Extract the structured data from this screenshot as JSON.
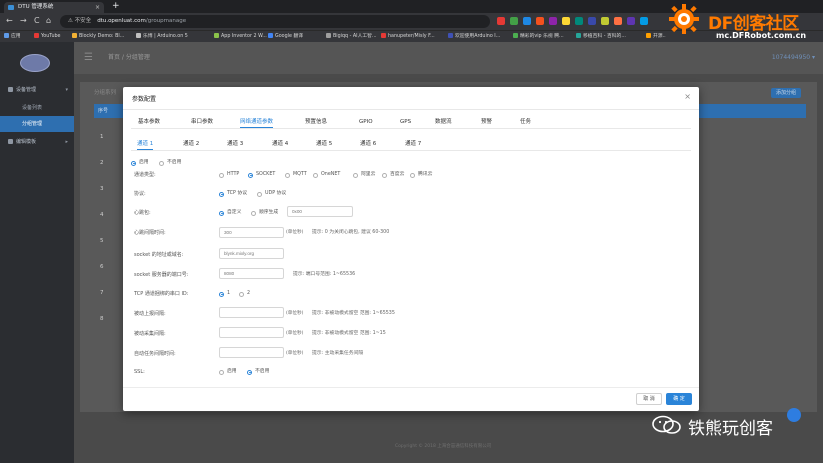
{
  "browser": {
    "tab_title": "DTU 管理系统",
    "tab_close": "×",
    "new_tab": "+",
    "back": "←",
    "forward": "→",
    "reload": "C",
    "home": "⌂",
    "security_label": "⚠ 不安全",
    "url_host": "dtu.openluat.com",
    "url_path": "/groupmanage",
    "bookmarks": [
      {
        "label": "应用",
        "color": "#5f9be8"
      },
      {
        "label": "YouTube",
        "color": "#e53935"
      },
      {
        "label": "Blockly Demo: Bl...",
        "color": "#f2b134"
      },
      {
        "label": "乐博 | Arduino.on 5",
        "color": "#c0c0c0"
      },
      {
        "label": "App Inventor 2 W...",
        "color": "#8bc34a"
      },
      {
        "label": "Google 翻译",
        "color": "#4285f4"
      },
      {
        "label": "Bigiqq - AI人工智...",
        "color": "#9e9e9e"
      },
      {
        "label": "hanupeter/Misly F...",
        "color": "#e53935"
      },
      {
        "label": "欢迎使用Arduino I...",
        "color": "#3f51b5"
      },
      {
        "label": "精彩的vip 乐视 腾...",
        "color": "#4caf50"
      },
      {
        "label": "移植百科 - 百科的...",
        "color": "#26a69a"
      },
      {
        "label": "开源..",
        "color": "#ffa000"
      }
    ],
    "extension_colors": [
      "#e53935",
      "#43a047",
      "#1e88e5",
      "#f4511e",
      "#8e24aa",
      "#fdd835",
      "#00897b",
      "#3949ab",
      "#c0ca33",
      "#ff7043",
      "#5e35b1",
      "#039be5"
    ]
  },
  "sidebar": {
    "logo_text": "LUAT",
    "items": [
      {
        "label": "设备管理",
        "sub": false,
        "active": false,
        "arrow": "▾"
      },
      {
        "label": "设备列表",
        "sub": true,
        "active": false
      },
      {
        "label": "分组管理",
        "sub": true,
        "active": true
      },
      {
        "label": "编辑模板",
        "sub": false,
        "active": false,
        "arrow": "▸"
      }
    ]
  },
  "topbar": {
    "menu_icon": "☰",
    "crumb": "首页  /  分组管理",
    "user": "1074494950 ▾"
  },
  "content": {
    "title": "分组系列",
    "add_button": "添加分组",
    "table_header": "序号",
    "rows": [
      "1",
      "2",
      "3",
      "4",
      "5",
      "6",
      "7",
      "8"
    ]
  },
  "footer_copyright": "Copyright © 2018 上海合宙通信科技有限公司",
  "modal": {
    "title": "参数配置",
    "close": "×",
    "tabs": [
      {
        "label": "基本参数",
        "active": false
      },
      {
        "label": "串口参数",
        "active": false
      },
      {
        "label": "网络通道参数",
        "active": true
      },
      {
        "label": "预置信息",
        "active": false
      },
      {
        "label": "GPIO",
        "active": false
      },
      {
        "label": "GPS",
        "active": false
      },
      {
        "label": "数据流",
        "active": false
      },
      {
        "label": "预警",
        "active": false
      },
      {
        "label": "任务",
        "active": false
      }
    ],
    "channels": [
      {
        "label": "通道 1",
        "active": true
      },
      {
        "label": "通道 2",
        "active": false
      },
      {
        "label": "通道 3",
        "active": false
      },
      {
        "label": "通道 4",
        "active": false
      },
      {
        "label": "通道 5",
        "active": false
      },
      {
        "label": "通道 6",
        "active": false
      },
      {
        "label": "通道 7",
        "active": false
      }
    ],
    "enable": {
      "options": [
        "启用",
        "不启用"
      ],
      "selected": 0
    },
    "channel_type": {
      "label": "通道类型:",
      "options": [
        "HTTP",
        "SOCKET",
        "MQTT",
        "OneNET",
        "阿里云",
        "百度云",
        "腾讯云"
      ],
      "selected": 1
    },
    "protocol": {
      "label": "协议:",
      "options": [
        "TCP 协议",
        "UDP 协议"
      ],
      "selected": 0
    },
    "heartbeat": {
      "label": "心跳包:",
      "options": [
        "自定义",
        "顺序生成"
      ],
      "selected": 0,
      "value": "0x00"
    },
    "heartbeat_interval": {
      "label": "心跳间隔时间:",
      "value": "300",
      "unit": "(单位秒)",
      "hint": "提示:  0 为关闭心跳包,  建议 60-300"
    },
    "socket_address": {
      "label": "socket 的地址或域名:",
      "value": "blynk.mixly.org"
    },
    "socket_port": {
      "label": "socket 服务器的端口号:",
      "value": "8080",
      "hint": "提示:  端口号范围:  1~65536"
    },
    "tcp_bind_serial": {
      "label": "TCP 通道捆绑的串口 ID:",
      "options": [
        "1",
        "2"
      ],
      "selected": 0
    },
    "passive_upload": {
      "label": "被动上报间隔:",
      "value": "",
      "unit": "(单位秒)",
      "hint": "提示:  非被动模式留空  范围:  1~65535"
    },
    "passive_collect": {
      "label": "被动采集间隔:",
      "value": "",
      "unit": "(单位秒)",
      "hint": "提示:  非被动模式留空  范围:  1~15"
    },
    "auto_task": {
      "label": "自动任务间隔时间:",
      "value": "",
      "unit": "(单位秒)",
      "hint": "提示:  主动采集任务间隔"
    },
    "ssl": {
      "label": "SSL:",
      "options": [
        "启用",
        "不启用"
      ],
      "selected": 1
    },
    "cancel": "取 消",
    "ok": "确 定"
  },
  "watermark": {
    "brand": "DF创客社区",
    "url": "mc.DFRobot.com.cn",
    "bottom_text": "铁熊玩创客",
    "brand_color": "#ff7a00"
  }
}
